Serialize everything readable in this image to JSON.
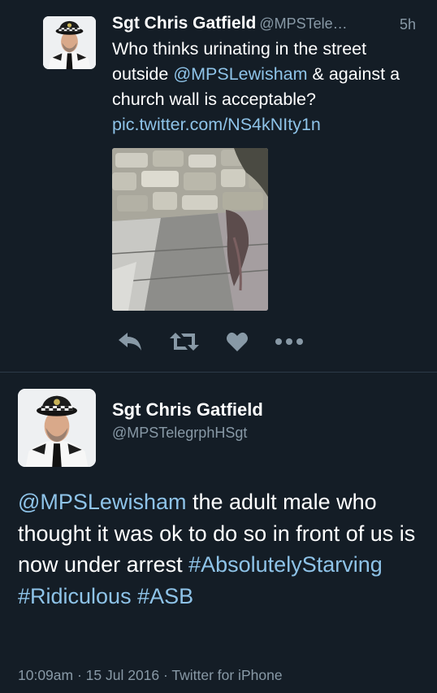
{
  "colors": {
    "background": "#141d26",
    "text_primary": "#ffffff",
    "text_secondary": "#8899a6",
    "link": "#8ec3e8",
    "divider": "#2c3a47"
  },
  "tweet1": {
    "author_name": "Sgt Chris Gatfield",
    "author_handle": "@MPSTele…",
    "timestamp": "5h",
    "text_part1": "Who thinks urinating in the street outside ",
    "mention": "@MPSLewisham",
    "text_part2": " & against a church wall is acceptable? ",
    "media_link": "pic.twitter.com/NS4kNIty1n",
    "actions": {
      "reply_icon": "reply-icon",
      "retweet_icon": "retweet-icon",
      "like_icon": "heart-icon",
      "more_icon": "more-icon"
    }
  },
  "tweet2": {
    "author_name": "Sgt Chris Gatfield",
    "author_handle": "@MPSTelegrphHSgt",
    "mention": "@MPSLewisham",
    "text_body": " the adult male who thought it was ok to do so in front  of us is now under arrest ",
    "hashtag1": "#AbsolutelyStarving",
    "hashtag2": "#Ridiculous",
    "hashtag3": "#ASB",
    "meta": "10:09am · 15 Jul 2016 · Twitter for iPhone"
  }
}
